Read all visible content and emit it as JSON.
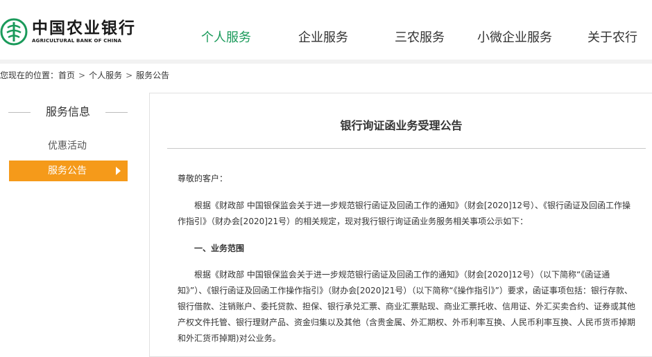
{
  "brand": {
    "name_cn": "中国农业银行",
    "name_en": "AGRICULTURAL BANK OF CHINA",
    "logo_color": "#1a9a5a"
  },
  "nav": {
    "items": [
      {
        "label": "个人服务",
        "active": true
      },
      {
        "label": "企业服务",
        "active": false
      },
      {
        "label": "三农服务",
        "active": false
      },
      {
        "label": "小微企业服务",
        "active": false
      },
      {
        "label": "关于农行",
        "active": false
      }
    ]
  },
  "breadcrumb": {
    "prefix": "您现在的位置：",
    "items": [
      "首页",
      "个人服务",
      "服务公告"
    ],
    "sep": ">"
  },
  "sidebar": {
    "title": "服务信息",
    "items": [
      {
        "label": "优惠活动",
        "active": false
      },
      {
        "label": "服务公告",
        "active": true
      }
    ],
    "active_color": "#f59a1a"
  },
  "article": {
    "title": "银行询证函业务受理公告",
    "greeting": "尊敬的客户：",
    "para1": "根据《财政部 中国银保监会关于进一步规范银行函证及回函工作的通知》（财会[2020]12号）、《银行函证及回函工作操作指引》（财办会[2020]21号）的相关规定，现对我行银行询证函业务服务相关事项公示如下：",
    "section1_heading": "一、业务范围",
    "para2": "根据《财政部 中国银保监会关于进一步规范银行函证及回函工作的通知》（财会[2020]12号）（以下简称“《函证通知》”）、《银行函证及回函工作操作指引》（财办会[2020]21号）（以下简称“《操作指引》”）要求，函证事项包括：银行存款、银行借款、注销账户、委托贷款、担保、银行承兑汇票、商业汇票贴现、商业汇票托收、信用证、外汇买卖合约、证券或其他产权文件托管、银行理财产品、资金归集以及其他（含贵金属、外汇期权、外币利率互换、人民币利率互换、人民币货币掉期和外汇货币掉期)对公业务。"
  }
}
